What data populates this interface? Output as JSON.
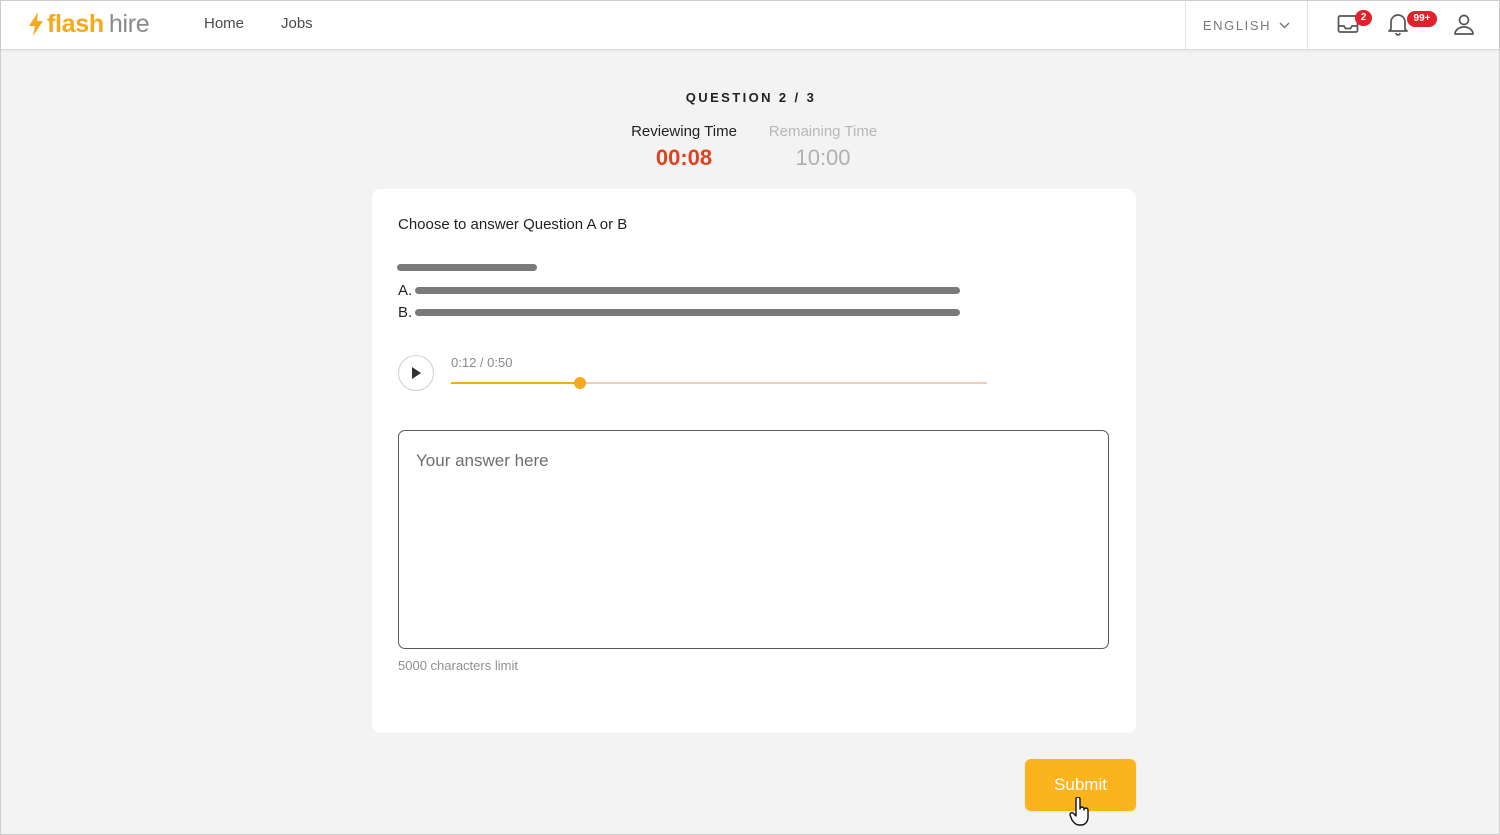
{
  "brand": {
    "word1": "flash",
    "word2": "hire",
    "color": "#f7a81b"
  },
  "nav": {
    "home": "Home",
    "jobs": "Jobs"
  },
  "header": {
    "language": "ENGLISH",
    "inbox_badge": "2",
    "notifications_badge": "99+",
    "icons": [
      "inbox-icon",
      "bell-icon",
      "user-icon",
      "chevron-down-icon"
    ]
  },
  "question": {
    "counter": "QUESTION 2 / 3",
    "reviewing_label": "Reviewing Time",
    "reviewing_value": "00:08",
    "remaining_label": "Remaining Time",
    "remaining_value": "10:00",
    "prompt": "Choose to answer Question A or B",
    "option_a_letter": "A.",
    "option_b_letter": "B."
  },
  "audio": {
    "time": "0:12 / 0:50",
    "progress": 0.24,
    "progress_color": "#f7a81b",
    "track_color": "#f6c9bf"
  },
  "answer": {
    "value": "",
    "placeholder": "Your answer here",
    "limit_text": "5000 characters limit"
  },
  "actions": {
    "submit": "Submit",
    "submit_color": "#fbb41e"
  },
  "colors": {
    "reviewing_time": "#e0411f",
    "badge": "#e3202b"
  }
}
